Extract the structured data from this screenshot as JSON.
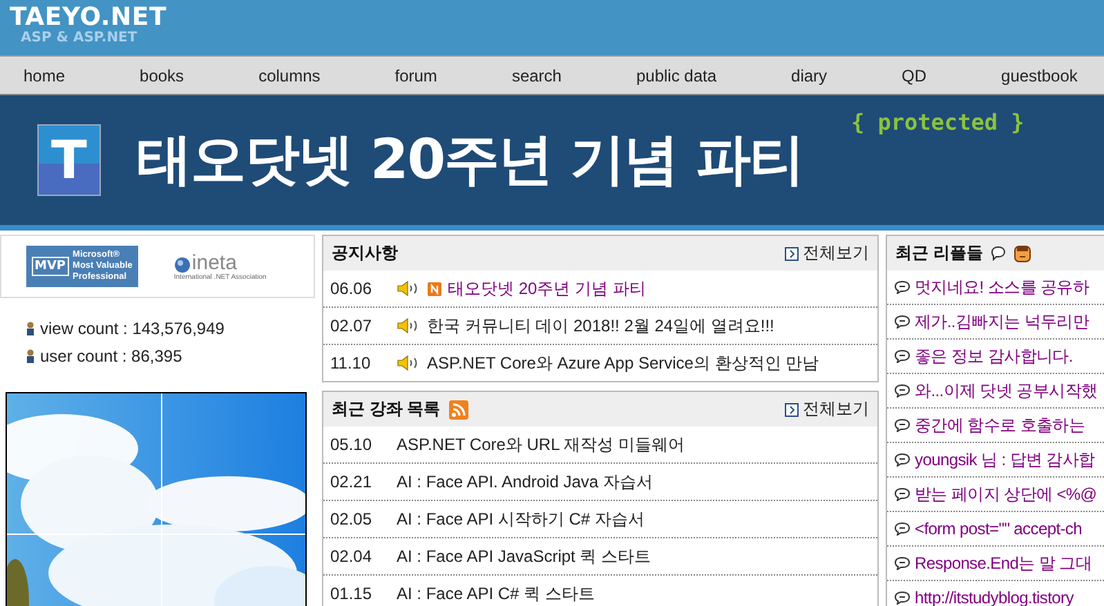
{
  "site": {
    "title": "TAEYO.NET",
    "subtitle": "ASP & ASP.NET"
  },
  "nav": [
    {
      "label": "home"
    },
    {
      "label": "books"
    },
    {
      "label": "columns"
    },
    {
      "label": "forum"
    },
    {
      "label": "search"
    },
    {
      "label": "public data"
    },
    {
      "label": "diary"
    },
    {
      "label": "QD"
    },
    {
      "label": "guestbook"
    }
  ],
  "banner": {
    "logo_letter": "T",
    "headline": "태오닷넷 20주년 기념 파티",
    "tag": "{ protected }"
  },
  "badges": {
    "mvp": {
      "mark": "MVP",
      "lines": [
        "Microsoft®",
        "Most Valuable",
        "Professional"
      ]
    },
    "ineta": {
      "name": "ineta",
      "caption": "International .NET Association"
    }
  },
  "stats": [
    {
      "label": "view count : 143,576,949"
    },
    {
      "label": "user count : 86,395"
    }
  ],
  "notices": {
    "title": "공지사항",
    "more": "전체보기",
    "rows": [
      {
        "date": "06.06",
        "title": "태오닷넷 20주년 기념 파티",
        "new": true,
        "visited": true
      },
      {
        "date": "02.07",
        "title": "한국 커뮤니티 데이 2018!! 2월 24일에 열려요!!!",
        "new": false,
        "visited": false
      },
      {
        "date": "11.10",
        "title": "ASP.NET Core와 Azure App Service의 환상적인 만남",
        "new": false,
        "visited": false
      }
    ]
  },
  "lectures": {
    "title": "최근 강좌 목록",
    "more": "전체보기",
    "rows": [
      {
        "date": "05.10",
        "title": "ASP.NET Core와 URL 재작성 미들웨어"
      },
      {
        "date": "02.21",
        "title": "AI : Face API. Android Java 자습서"
      },
      {
        "date": "02.05",
        "title": "AI : Face API 시작하기 C# 자습서"
      },
      {
        "date": "02.04",
        "title": "AI : Face API JavaScript 퀵 스타트"
      },
      {
        "date": "01.15",
        "title": "AI : Face API C# 퀵 스타트"
      }
    ]
  },
  "replies": {
    "title": "최근 리플들",
    "rows": [
      {
        "text": "멋지네요! 소스를 공유하"
      },
      {
        "text": "제가..김빠지는 넉두리만"
      },
      {
        "text": "좋은 정보 감사합니다."
      },
      {
        "text": "와...이제 닷넷 공부시작했"
      },
      {
        "text": "중간에 함수로 호출하는"
      },
      {
        "text": "youngsik 님 : 답변 감사합"
      },
      {
        "text": "받는 페이지 상단에 <%@"
      },
      {
        "text": "<form post=\"\" accept-ch"
      },
      {
        "text": "Response.End는 말 그대"
      },
      {
        "text": "http://itstudyblog.tistory"
      }
    ]
  }
}
